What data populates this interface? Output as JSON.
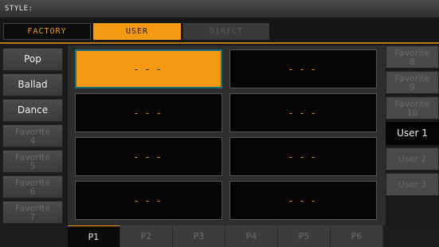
{
  "title": "STYLE:",
  "bank_tabs": [
    "FACTORY",
    "USER",
    "DIRECT"
  ],
  "left_buttons": [
    "Pop",
    "Ballad",
    "Dance",
    "Favorite\n4",
    "Favorite\n5",
    "Favorite\n6",
    "Favorite\n7"
  ],
  "right_buttons": [
    "Favorite\n8",
    "Favorite\n9",
    "Favorite\n10",
    "User 1",
    "User 2",
    "User 3"
  ],
  "slots": [
    "- - -",
    "- - -",
    "- - -",
    "- - -",
    "- - -",
    "- - -",
    "- - -",
    "- - -"
  ],
  "pages": [
    "P1",
    "P2",
    "P3",
    "P4",
    "P5",
    "P6"
  ],
  "colors": {
    "accent": "#f39a12",
    "accent_text": "#f19a14",
    "selection_border": "#1f6d82"
  }
}
